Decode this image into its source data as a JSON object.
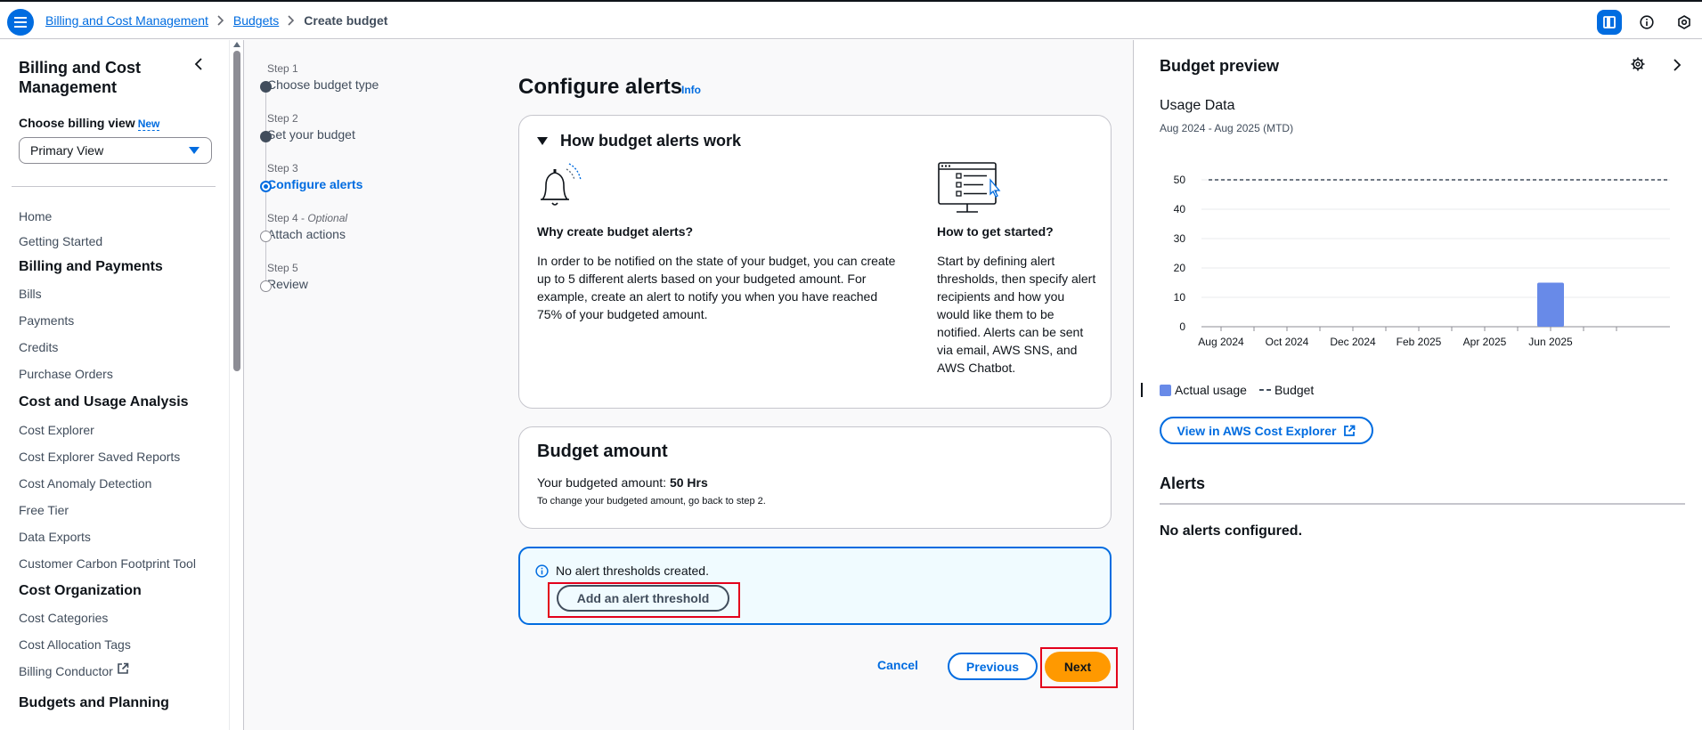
{
  "breadcrumb": [
    "Billing and Cost Management",
    "Budgets",
    "Create budget"
  ],
  "sidebar": {
    "title": "Billing and Cost Management",
    "billing_view_label": "Choose billing view",
    "billing_view_badge": "New",
    "billing_view_value": "Primary View",
    "items": [
      {
        "type": "item",
        "label": "Home"
      },
      {
        "type": "item",
        "label": "Getting Started"
      },
      {
        "type": "head",
        "label": "Billing and Payments"
      },
      {
        "type": "item",
        "label": "Bills"
      },
      {
        "type": "item",
        "label": "Payments"
      },
      {
        "type": "item",
        "label": "Credits"
      },
      {
        "type": "item",
        "label": "Purchase Orders"
      },
      {
        "type": "head",
        "label": "Cost and Usage Analysis"
      },
      {
        "type": "item",
        "label": "Cost Explorer"
      },
      {
        "type": "item",
        "label": "Cost Explorer Saved Reports"
      },
      {
        "type": "item",
        "label": "Cost Anomaly Detection"
      },
      {
        "type": "item",
        "label": "Free Tier"
      },
      {
        "type": "item",
        "label": "Data Exports"
      },
      {
        "type": "item",
        "label": "Customer Carbon Footprint Tool"
      },
      {
        "type": "head",
        "label": "Cost Organization"
      },
      {
        "type": "item",
        "label": "Cost Categories"
      },
      {
        "type": "item",
        "label": "Cost Allocation Tags"
      },
      {
        "type": "item",
        "label": "Billing Conductor",
        "external": true
      },
      {
        "type": "head",
        "label": "Budgets and Planning"
      }
    ]
  },
  "steps": [
    {
      "num": "Step 1",
      "optional": "",
      "name": "Choose budget type",
      "state": "done"
    },
    {
      "num": "Step 2",
      "optional": "",
      "name": "Set your budget",
      "state": "done"
    },
    {
      "num": "Step 3",
      "optional": "",
      "name": "Configure alerts",
      "state": "current"
    },
    {
      "num": "Step 4 - ",
      "optional": "Optional",
      "name": "Attach actions",
      "state": "todo"
    },
    {
      "num": "Step 5",
      "optional": "",
      "name": "Review",
      "state": "todo"
    }
  ],
  "main": {
    "title": "Configure alerts",
    "info": "Info",
    "how_card": {
      "title": "How budget alerts work",
      "left_heading": "Why create budget alerts?",
      "left_text": "In order to be notified on the state of your budget, you can create up to 5 different alerts based on your budgeted amount. For example, create an alert to notify you when you have reached 75% of your budgeted amount.",
      "right_heading": "How to get started?",
      "right_text": "Start by defining alert thresholds, then specify alert recipients and how you would like them to be notified. Alerts can be sent via email, AWS SNS, and AWS Chatbot."
    },
    "budget_card": {
      "title": "Budget amount",
      "amount_label": "Your budgeted amount: ",
      "amount_value": "50 Hrs",
      "hint": "To change your budgeted amount, go back to step 2."
    },
    "alert_info": {
      "message": "No alert thresholds created.",
      "button": "Add an alert threshold"
    },
    "footer": {
      "cancel": "Cancel",
      "previous": "Previous",
      "next": "Next"
    }
  },
  "preview": {
    "title": "Budget preview",
    "usage_title": "Usage Data",
    "usage_range": "Aug 2024 - Aug 2025 (MTD)",
    "legend_actual": "Actual usage",
    "legend_budget": "Budget",
    "cost_explorer_button": "View in AWS Cost Explorer",
    "alerts_title": "Alerts",
    "alerts_empty": "No alerts configured."
  },
  "chart_data": {
    "type": "bar",
    "categories": [
      "Aug 2024",
      "Sep 2024",
      "Oct 2024",
      "Nov 2024",
      "Dec 2024",
      "Jan 2025",
      "Feb 2025",
      "Mar 2025",
      "Apr 2025",
      "May 2025",
      "Jun 2025",
      "Jul 2025",
      "Aug 2025"
    ],
    "x_tick_labels": [
      "Aug 2024",
      "Oct 2024",
      "Dec 2024",
      "Feb 2025",
      "Apr 2025",
      "Jun 2025"
    ],
    "series": [
      {
        "name": "Actual usage",
        "values": [
          0,
          0,
          0,
          0,
          0,
          0,
          0,
          0,
          0,
          0,
          15,
          0,
          0
        ],
        "color": "#688ae8"
      }
    ],
    "budget_line": {
      "name": "Budget",
      "value": 50
    },
    "ylim": [
      0,
      50
    ],
    "yticks": [
      0,
      10,
      20,
      30,
      40,
      50
    ],
    "grid": true,
    "legend": "bottom-left"
  },
  "colors": {
    "primary": "#006ce0",
    "next_button": "#ff9900",
    "highlight": "#e3001b"
  }
}
